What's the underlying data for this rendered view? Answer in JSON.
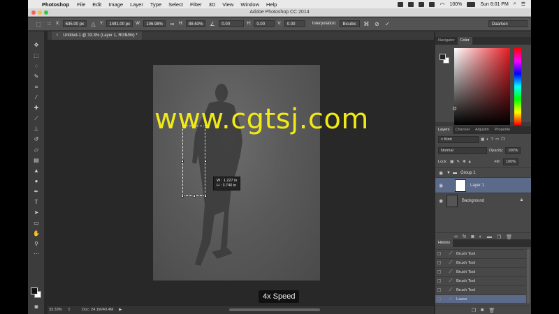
{
  "menubar": {
    "app_name": "Photoshop",
    "items": [
      "File",
      "Edit",
      "Image",
      "Layer",
      "Type",
      "Select",
      "Filter",
      "3D",
      "View",
      "Window",
      "Help"
    ],
    "battery": "100%",
    "clock": "Sun 6:01 PM"
  },
  "window": {
    "title": "Adobe Photoshop CC 2014"
  },
  "options": {
    "x_label": "X:",
    "x_value": "635.00 px",
    "y_label": "Y:",
    "y_value": "1491.00 px",
    "w_label": "W:",
    "w_value": "106.98%",
    "h_label": "H:",
    "h_value": "88.63%",
    "angle_value": "0.00",
    "hskew_label": "H:",
    "hskew_value": "0.00",
    "vskew_label": "V:",
    "vskew_value": "0.00",
    "interp_label": "Interpolation:",
    "interp_value": "Bicubic",
    "workspace": "Daarken"
  },
  "document": {
    "tab_title": "Untitled-1 @ 33.3% (Layer 1, RGB/8#) *",
    "measure_w": "W : 1.227 in",
    "measure_h": "H : 3.740 in",
    "watermark": "www.cgtsj.com",
    "speed_label": "4x Speed"
  },
  "status": {
    "zoom": "33.33%",
    "doc_size": "Doc: 24.1M/40.4M"
  },
  "panels": {
    "top_tabs": [
      "Navigator",
      "Color"
    ],
    "active_top_tab": "Color",
    "layer_tabs": [
      "Layers",
      "Channel",
      "Adjustm",
      "Propertie"
    ],
    "kind_label": "Kind",
    "blend_mode": "Normal",
    "opacity_label": "Opacity:",
    "opacity_value": "100%",
    "lock_label": "Lock:",
    "fill_label": "Fill:",
    "fill_value": "100%",
    "layers": [
      {
        "name": "Group 1",
        "type": "group"
      },
      {
        "name": "Layer 1",
        "type": "layer",
        "selected": true
      },
      {
        "name": "Background",
        "type": "background",
        "locked": true
      }
    ],
    "history_title": "History",
    "history": [
      {
        "name": "Brush Tool"
      },
      {
        "name": "Brush Tool"
      },
      {
        "name": "Brush Tool"
      },
      {
        "name": "Brush Tool"
      },
      {
        "name": "Brush Tool"
      },
      {
        "name": "Lasso",
        "selected": true
      }
    ]
  }
}
